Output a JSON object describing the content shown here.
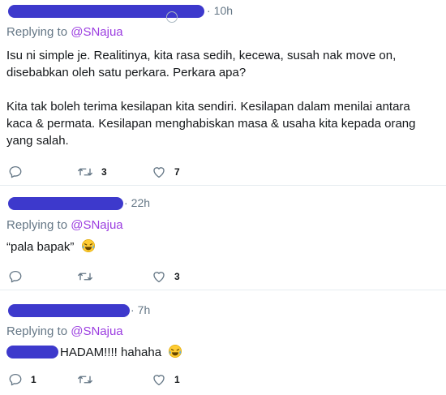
{
  "tweets": [
    {
      "time": "10h",
      "replying_prefix": "Replying to",
      "replying_handle": "@SNajua",
      "paragraphs": [
        "Isu ni simple je. Realitinya, kita rasa sedih, kecewa, susah nak move on, disebabkan oleh satu perkara. Perkara apa?",
        "Kita tak boleh terima kesilapan kita sendiri. Kesilapan dalam menilai antara kaca & permata. Kesilapan menghabiskan masa & usaha kita kepada orang yang salah."
      ],
      "reply_count": "",
      "retweet_count": "3",
      "like_count": "7"
    },
    {
      "time": "22h",
      "replying_prefix": "Replying to",
      "replying_handle": "@SNajua",
      "text": "“pala bapak”",
      "emoji": "tears-of-joy",
      "reply_count": "",
      "retweet_count": "",
      "like_count": "3"
    },
    {
      "time": "7h",
      "replying_prefix": "Replying to",
      "replying_handle": "@SNajua",
      "text": "HADAM!!!! hahaha",
      "emoji": "tears-of-joy",
      "reply_count": "1",
      "retweet_count": "",
      "like_count": "1"
    }
  ],
  "colors": {
    "redaction": "#3d39cc",
    "handle": "#9b3de0",
    "muted": "#657786",
    "divider": "#e6ecf0"
  },
  "icons": {
    "reply": "reply-icon",
    "retweet": "retweet-icon",
    "like": "heart-icon"
  }
}
